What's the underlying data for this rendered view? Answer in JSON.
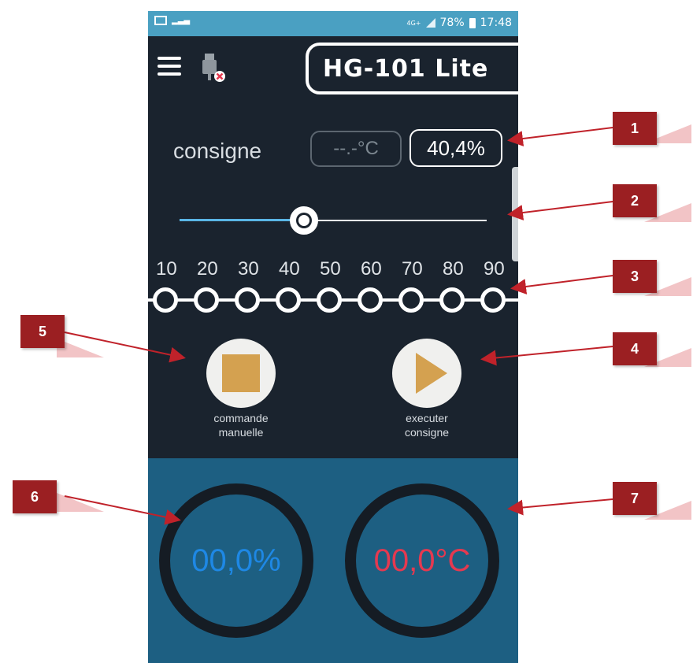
{
  "statusbar": {
    "network": "4G+",
    "battery": "78%",
    "time": "17:48"
  },
  "header": {
    "title": "HG-101 Lite"
  },
  "setpoint": {
    "label": "consigne",
    "temperature": "--.-°C",
    "percent": "40,4%",
    "slider_level_percent": 40.4
  },
  "presets": {
    "ticks": [
      "10",
      "20",
      "30",
      "40",
      "50",
      "60",
      "70",
      "80",
      "90"
    ]
  },
  "actions": {
    "manual": {
      "caption_line1": "commande",
      "caption_line2": "manuelle"
    },
    "execute": {
      "caption_line1": "executer",
      "caption_line2": "consigne"
    }
  },
  "gauges": {
    "humidity": "00,0%",
    "temperature": "00,0°C"
  },
  "callouts": [
    "1",
    "2",
    "3",
    "4",
    "5",
    "6",
    "7"
  ],
  "colors": {
    "accent_blue": "#1e88e5",
    "accent_red": "#e53950",
    "button_gold": "#d4a150",
    "panel_blue": "#1d5f82",
    "callout_red": "#9b1f22"
  }
}
